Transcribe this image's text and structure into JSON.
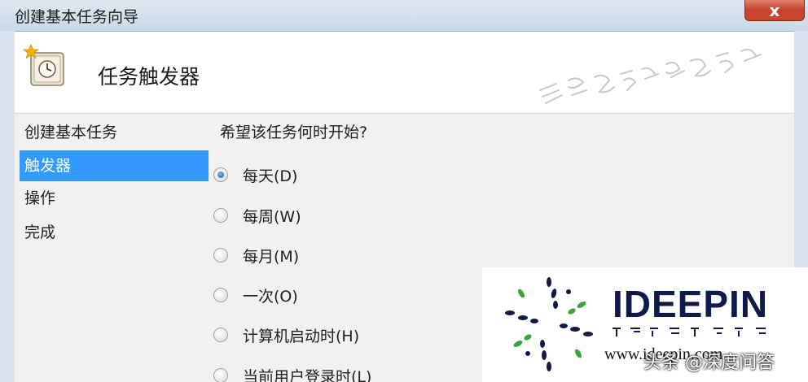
{
  "window": {
    "title": "创建基本任务向导",
    "close_label": "x"
  },
  "header": {
    "title": "任务触发器",
    "icon": "clock-icon"
  },
  "nav": {
    "items": [
      {
        "label": "创建基本任务",
        "selected": false
      },
      {
        "label": "触发器",
        "selected": true
      },
      {
        "label": "操作",
        "selected": false
      },
      {
        "label": "完成",
        "selected": false
      }
    ]
  },
  "main": {
    "question": "希望该任务何时开始?",
    "options": [
      {
        "label": "每天(D)",
        "checked": true
      },
      {
        "label": "每周(W)",
        "checked": false
      },
      {
        "label": "每月(M)",
        "checked": false
      },
      {
        "label": "一次(O)",
        "checked": false
      },
      {
        "label": "计算机启动时(H)",
        "checked": false
      },
      {
        "label": "当前用户登录时(L)",
        "checked": false
      }
    ]
  },
  "watermark": {
    "logo_text": "IDEEPIN",
    "url": "www.ideepin.com",
    "overlay": "头条 @深度问答"
  },
  "colors": {
    "selection": "#3399ff",
    "close_button": "#c8452c",
    "logo_navy": "#0e1a4a",
    "logo_green": "#3aa63a"
  }
}
